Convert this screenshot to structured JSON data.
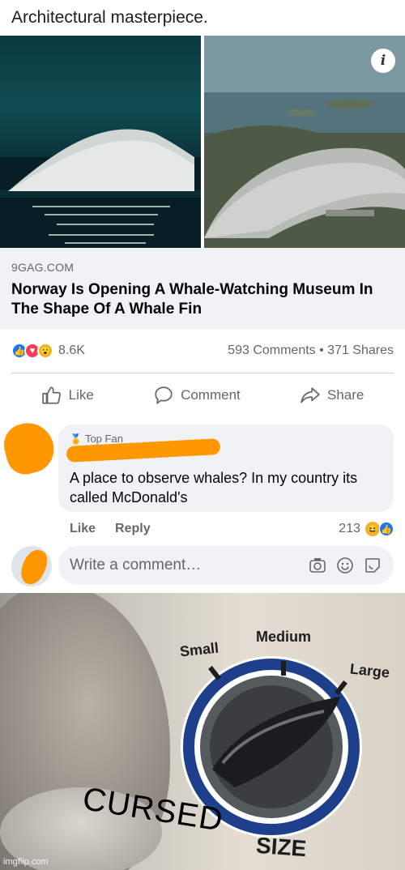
{
  "post": {
    "title": "Architectural masterpiece."
  },
  "link_preview": {
    "domain": "9GAG.COM",
    "headline": "Norway Is Opening A Whale-Watching Museum In The Shape Of A Whale Fin",
    "info_badge": "i"
  },
  "reactions": {
    "count": "8.6K",
    "comments_shares": "593 Comments • 371 Shares",
    "icons": [
      "like-reaction-icon",
      "love-reaction-icon",
      "wow-reaction-icon"
    ]
  },
  "actions": {
    "like": "Like",
    "comment": "Comment",
    "share": "Share"
  },
  "comment": {
    "badge": "Top Fan",
    "text": "A place to observe whales? In my country its called McDonald's",
    "like": "Like",
    "reply": "Reply",
    "reaction_count": "213"
  },
  "composer": {
    "placeholder": "Write a comment…",
    "icons": [
      "camera-icon",
      "emoji-icon",
      "sticker-icon"
    ]
  },
  "meme": {
    "label_small": "Small",
    "label_medium": "Medium",
    "label_large": "Large",
    "overlay_text": "CURSED",
    "size_text": "SIZE",
    "watermark": "imgflip.com"
  },
  "colors": {
    "brand_blue": "#1877f2",
    "redaction_orange": "#ff9800",
    "bubble_gray": "#f0f2f5",
    "secondary_text": "#65676b"
  }
}
